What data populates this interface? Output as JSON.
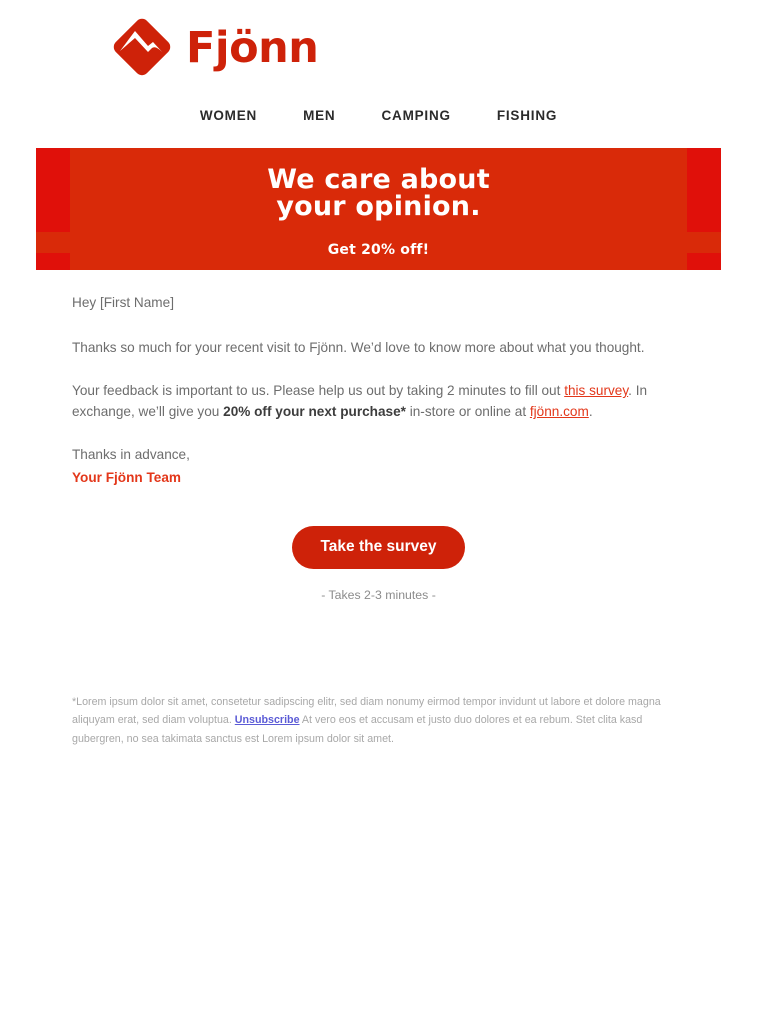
{
  "brand": {
    "name": "Fjönn",
    "logo_icon": "mountain-diamond-logo-icon",
    "accent_color": "#CE2209",
    "banner_color": "#D92A09",
    "banner_block_color": "#E0100A",
    "link_color": "#E3371A",
    "unsubscribe_link_color": "#5B5BD6"
  },
  "nav": {
    "items": [
      {
        "label": "WOMEN"
      },
      {
        "label": "MEN"
      },
      {
        "label": "CAMPING"
      },
      {
        "label": "FISHING"
      }
    ]
  },
  "hero": {
    "title_line1": "We care about",
    "title_line2": "your opinion.",
    "subtitle": "Get 20% off!"
  },
  "body": {
    "greeting": "Hey  [First Name]",
    "paragraph_thanks": "Thanks so much for your recent visit to Fjönn. We’d love to know more about what you thought.",
    "feedback_part1": "Your feedback is important to us. Please help us out by taking 2 minutes to fill out ",
    "survey_link": "this survey",
    "feedback_part2": ". In exchange, we’ll give you ",
    "offer_bold": "20% off your next purchase*",
    "feedback_part3": " in-store or online at ",
    "site_link": "fjönn.com",
    "feedback_part4": ".",
    "signoff": "Thanks in advance,",
    "team": "Your Fjönn Team"
  },
  "cta": {
    "button_label": "Take the survey",
    "note": "- Takes 2-3 minutes -"
  },
  "footer": {
    "text_part1": "*Lorem ipsum dolor sit amet, consetetur sadipscing elitr, sed diam nonumy eirmod tempor invidunt ut labore et dolore magna aliquyam erat, sed diam voluptua. ",
    "unsubscribe_label": "Unsubscribe",
    "text_part2": " At vero eos et accusam et justo duo dolores et ea rebum. Stet clita kasd gubergren, no sea takimata sanctus est Lorem ipsum dolor sit amet."
  }
}
